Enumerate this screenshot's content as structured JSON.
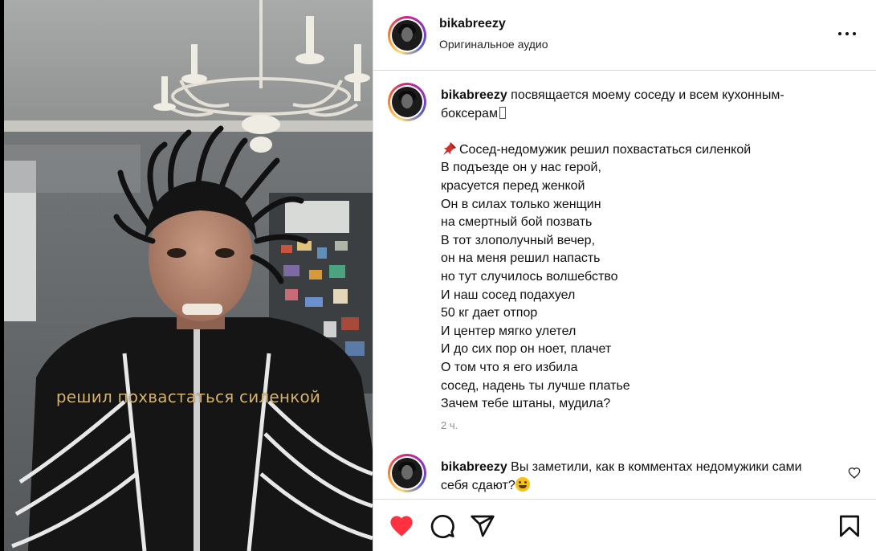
{
  "media": {
    "overlay_caption": "решил похвастаться силенкой"
  },
  "header": {
    "username": "bikabreezy",
    "audio_label": "Оригинальное аудио"
  },
  "post": {
    "username": "bikabreezy",
    "first_line": "посвящается моему соседу и всем кухонным-",
    "second_line": "боксерам",
    "lines": [
      "Сосед-недомужик решил похвастаться силенкой",
      "В подъезде он у нас герой,",
      "красуется перед женкой",
      "Он в силах только женщин",
      "на смертный бой позвать",
      "В тот злополучный вечер,",
      "он на меня решил напасть",
      "но тут случилось волшебство",
      "И наш сосед подахуел",
      "50 кг дает отпор",
      "И центер мягко улетел",
      "И до сих пор он ноет, плачет",
      "О том что я его избила",
      "сосед, надень ты лучше платье",
      "Зачем тебе штаны, мудила?"
    ],
    "time": "2 ч."
  },
  "comment": {
    "username": "bikabreezy",
    "text_line1": "Вы заметили, как в комментах недомужики сами",
    "text_line2": "себя сдают?"
  },
  "icons": {
    "heart_color": "#ff3040"
  }
}
